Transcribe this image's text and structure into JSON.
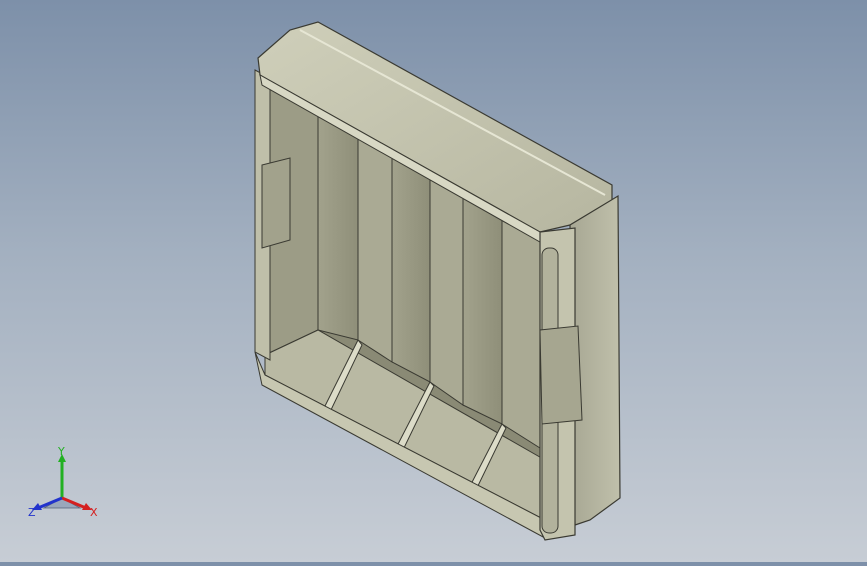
{
  "viewport": {
    "model": "battery-holder-tray"
  },
  "triad": {
    "x_label": "X",
    "y_label": "Y",
    "z_label": "Z",
    "x_color": "#d42020",
    "y_color": "#22b022",
    "z_color": "#2233cc"
  },
  "colors": {
    "body_light": "#c4c4ae",
    "body_mid": "#a8a892",
    "body_dark": "#7d7d6b",
    "edge": "#3a3a32"
  }
}
